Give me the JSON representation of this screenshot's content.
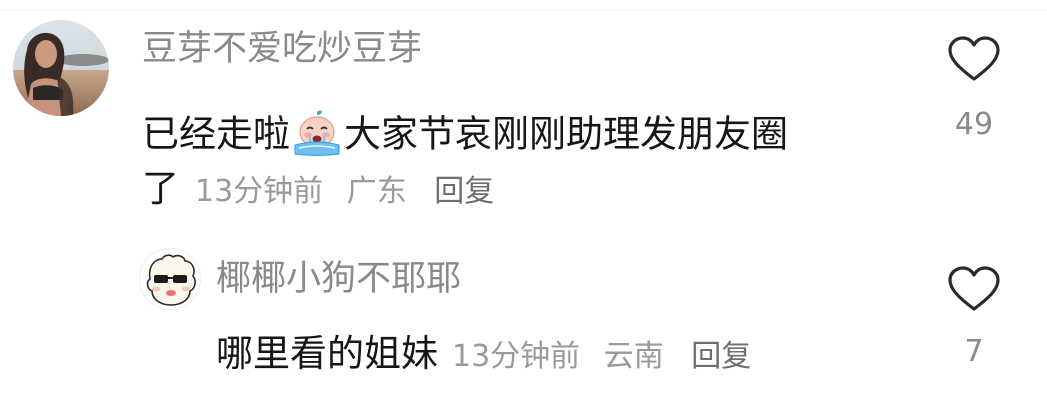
{
  "comments": [
    {
      "username": "豆芽不爱吃炒豆芽",
      "text_before_emoji": "已经走啦",
      "emoji": "crying-face-emoji",
      "text_after_emoji": "大家节哀刚刚助理发朋友圈",
      "text_line2": "了",
      "time": "13分钟前",
      "location": "广东",
      "reply_label": "回复",
      "likes": "49"
    },
    {
      "username": "椰椰小狗不耶耶",
      "text": "哪里看的姐妹",
      "time": "13分钟前",
      "location": "云南",
      "reply_label": "回复",
      "likes": "7"
    }
  ],
  "colors": {
    "username": "#8a8a8a",
    "content": "#161616",
    "meta": "#9a9a9a",
    "icon_stroke": "#2a2a2a"
  }
}
